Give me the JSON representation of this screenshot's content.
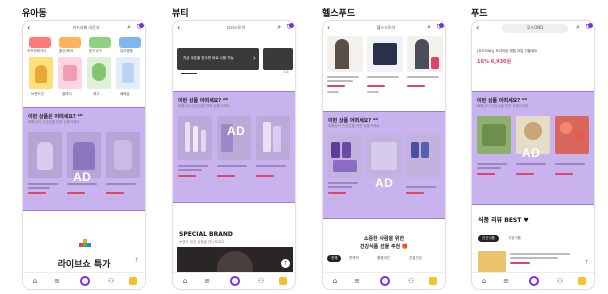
{
  "columns": [
    {
      "title": "유아동"
    },
    {
      "title": "뷰티"
    },
    {
      "title": "헬스푸드"
    },
    {
      "title": "푸드"
    }
  ],
  "common": {
    "ad_label": "AD",
    "ad_title": "이런 상품 어떠세요? ᴬᴰ",
    "ad_subtitle": "회원님이 관심있을 만한 상품이에요"
  },
  "kids": {
    "shop_name": "키즈카페 라운지",
    "categories": [
      "키즈카페가다",
      "출산/육아",
      "완구교구",
      "유아용품"
    ],
    "brands": [
      "브랜드관",
      "클래식",
      "레고",
      "베베숲"
    ],
    "ad_title": "이런 상품은 어떠세요? ᴬᴰ",
    "live_banner": "라이브쇼 특가"
  },
  "beauty": {
    "shop_name": "뷰티스토어",
    "promo_text": "지금 쿠폰을 받으면 바로 사용 가능",
    "page_indicator": "1/1",
    "special_brand": "SPECIAL BRAND",
    "special_brand_sub": "브랜드 대표 상품을 만나보세요"
  },
  "health": {
    "shop_name": "헬스스토어",
    "section_line1": "소중한 사람을 위한",
    "section_line2": "건강식품 선물 추천 🎁",
    "filter_tabs": [
      "전체",
      "면역력",
      "혈행개선",
      "관절건강"
    ]
  },
  "food": {
    "shop_name": "푸드OND",
    "product_title": "[푸드OND] 프리미엄 제철 과일 선물세트",
    "product_price": "16% 6,930원",
    "review_title": "식품 리뷰 BEST ♥",
    "review_tabs": [
      "신선식품",
      "가공식품"
    ]
  },
  "colors": {
    "ad_band": "#c9b3ef",
    "accent": "#7b2fe0",
    "price_red": "#e0446a"
  }
}
